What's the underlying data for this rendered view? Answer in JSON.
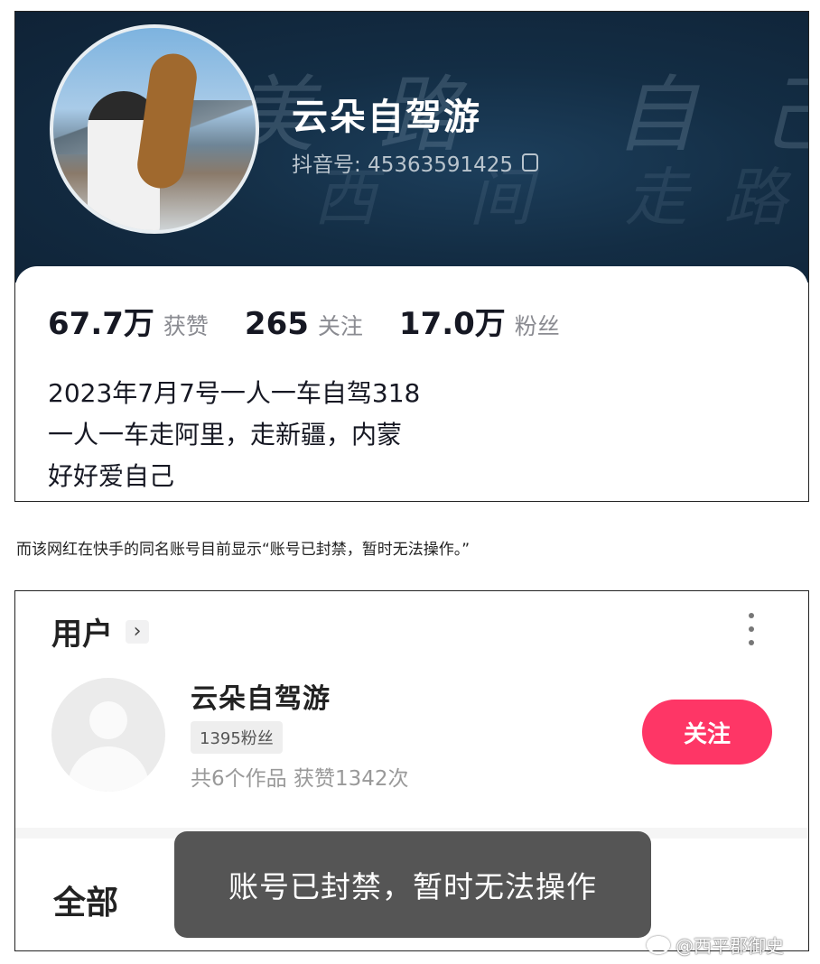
{
  "douyin": {
    "banner_text_top": "美路 自己走",
    "banner_text_bottom": "西 间 走路",
    "name": "云朵自驾游",
    "id_label": "抖音号: 45363591425",
    "stats": [
      {
        "num": "67.7万",
        "label": "获赞"
      },
      {
        "num": "265",
        "label": "关注"
      },
      {
        "num": "17.0万",
        "label": "粉丝"
      }
    ],
    "bio": [
      "2023年7月7号一人一车自驾318",
      "一人一车走阿里，走新疆，内蒙",
      "好好爱自己"
    ]
  },
  "caption": "而该网红在快手的同名账号目前显示“账号已封禁，暂时无法操作。”",
  "kuaishou": {
    "section_title": "用户",
    "chevron": "›",
    "name": "云朵自驾游",
    "fans_badge": "1395粉丝",
    "works": "共6个作品 获赞1342次",
    "follow_label": "关注",
    "tab_all": "全部",
    "toast": "账号已封禁，暂时无法操作",
    "accent_color": "#fe3666"
  },
  "watermark": "@西平郡御史"
}
